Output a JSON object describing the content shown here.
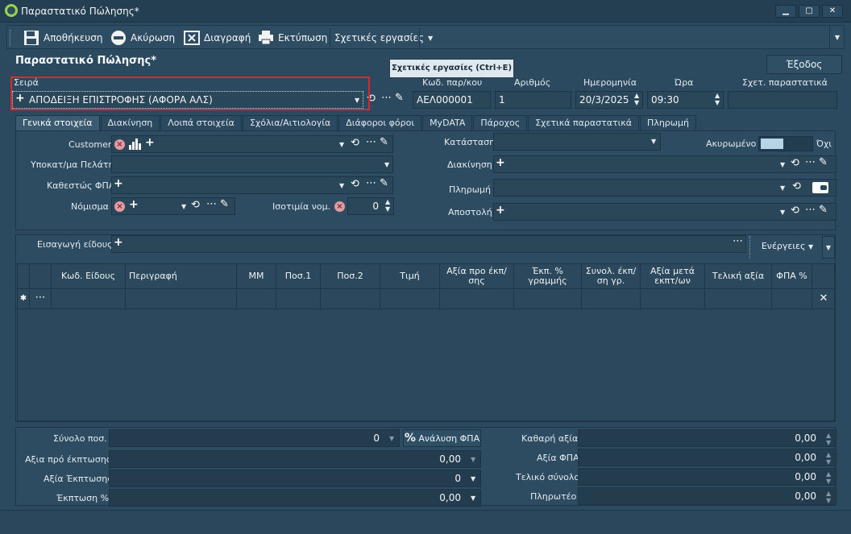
{
  "window": {
    "title": "Παραστατικό Πώλησης*"
  },
  "toolbar": {
    "save": "Αποθήκευση",
    "cancel": "Ακύρωση",
    "delete": "Διαγραφή",
    "print": "Εκτύπωση",
    "related": "Σχετικές εργασίες"
  },
  "page": {
    "title": "Παραστατικό Πώλησης*",
    "exit": "Έξοδος",
    "tooltip": "Σχετικές εργασίες (Ctrl+E)"
  },
  "header": {
    "series_label": "Σειρά",
    "series_value": "ΑΠΟΔΕΙΞΗ ΕΠΙΣΤΡΟΦΗΣ (ΑΦΟΡΑ ΑΛΣ)",
    "code_label": "Κωδ. παρ/κου",
    "code_value": "ΑΕΛ000001",
    "number_label": "Αριθμός",
    "number_value": "1",
    "date_label": "Ημερομηνία",
    "date_value": "20/3/2025",
    "time_label": "Ώρα",
    "time_value": "09:30",
    "related_label": "Σχετ. παραστατικά"
  },
  "tabs": [
    "Γενικά στοιχεία",
    "Διακίνηση",
    "Λοιπά στοιχεία",
    "Σχόλια/Αιτιολογία",
    "Διάφοροι φόροι",
    "MyDATA",
    "Πάροχος",
    "Σχετικά παραστατικά",
    "Πληρωμή"
  ],
  "general": {
    "customer": "Customer",
    "branch": "Υποκατ/μα Πελάτη",
    "vat_status": "Καθεστώς ΦΠΑ",
    "currency": "Νόμισμα",
    "parity": "Ισοτιμία νομ.",
    "parity_value": "0",
    "status": "Κατάσταση",
    "cancelled": "Ακυρωμένο",
    "cancelled_value": "Όχι",
    "shipping": "Διακίνηση",
    "payment": "Πληρωμή",
    "delivery": "Αποστολή"
  },
  "items": {
    "insert_label": "Εισαγωγή είδους",
    "actions": "Ενέργειες",
    "columns": [
      "Κωδ. Είδους",
      "Περιγραφή",
      "ΜΜ",
      "Ποσ.1",
      "Ποσ.2",
      "Τιμή",
      "Αξία προ έκπ/σης",
      "Έκπ. % γραμμής",
      "Συνολ. έκπ/ση γρ.",
      "Αξία μετά εκπτ/ων",
      "Τελική αξία",
      "ΦΠΑ %"
    ]
  },
  "totals": {
    "qty_label": "Σύνολο ποσ.",
    "qty_value": "0",
    "vat_analysis": "Ανάλυση ΦΠΑ",
    "before_disc_label": "Αξια πρό έκπτωσης",
    "before_disc_value": "0,00",
    "disc_value_label": "Αξία Έκπτωσης",
    "disc_value": "0",
    "disc_pct_label": "Έκπτωση %",
    "disc_pct_value": "0,00",
    "net_label": "Καθαρή αξία",
    "net_value": "0,00",
    "vat_label": "Αξία ΦΠΑ",
    "vat_value": "0,00",
    "total_label": "Τελικό σύνολο",
    "total_value": "0,00",
    "payable_label": "Πληρωτέο",
    "payable_value": "0,00"
  },
  "colors": {
    "accent_red": "#e0262a",
    "background": "#2c4a5f"
  }
}
